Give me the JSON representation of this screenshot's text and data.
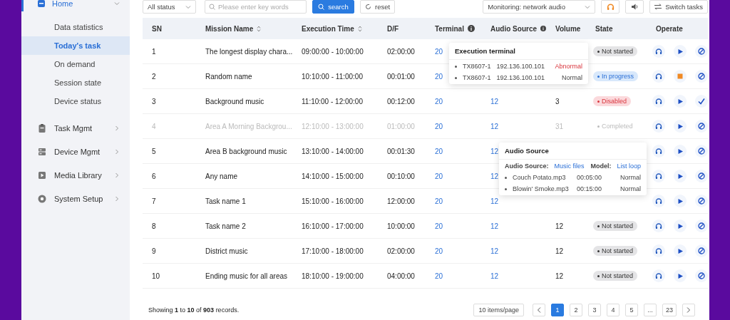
{
  "sidebar": {
    "items": [
      {
        "label": "Home",
        "expanded": true,
        "selected": true,
        "children": [
          {
            "label": "Data statistics",
            "selected": false
          },
          {
            "label": "Today's task",
            "selected": true
          },
          {
            "label": "On demand",
            "selected": false
          },
          {
            "label": "Session state",
            "selected": false
          },
          {
            "label": "Device status",
            "selected": false
          }
        ]
      },
      {
        "label": "Task Mgmt",
        "expanded": false,
        "selected": false
      },
      {
        "label": "Device Mgmt",
        "expanded": false,
        "selected": false
      },
      {
        "label": "Media Library",
        "expanded": false,
        "selected": false
      },
      {
        "label": "System Setup",
        "expanded": false,
        "selected": false
      }
    ]
  },
  "toolbar": {
    "status_filter": {
      "value": "All status"
    },
    "search": {
      "placeholder": "Please enter key words"
    },
    "search_button": "search",
    "reset_button": "reset",
    "monitor_select": {
      "value": "Monitoring: network audio"
    },
    "switch_button": "Switch tasks"
  },
  "table": {
    "columns": [
      {
        "label": "SN",
        "sortable": false,
        "info": false
      },
      {
        "label": "Mission Name",
        "sortable": true,
        "info": false
      },
      {
        "label": "Execution Time",
        "sortable": true,
        "info": false
      },
      {
        "label": "D/F",
        "sortable": false,
        "info": false
      },
      {
        "label": "Terminal",
        "sortable": false,
        "info": true
      },
      {
        "label": "Audio Source",
        "sortable": false,
        "info": true
      },
      {
        "label": "Volume",
        "sortable": false,
        "info": false
      },
      {
        "label": "State",
        "sortable": false,
        "info": false
      },
      {
        "label": "Operate",
        "sortable": false,
        "info": false
      }
    ],
    "rows": [
      {
        "sn": "1",
        "name": "The longest display chara...",
        "time": "09:00:00 - 10:00:00",
        "df": "02:00:00",
        "terminal": "20",
        "state": {
          "label": "Not started",
          "kind": "idle"
        },
        "actions": [
          {
            "kind": "listen"
          },
          {
            "kind": "play"
          },
          {
            "kind": "ban"
          }
        ],
        "muted": false
      },
      {
        "sn": "2",
        "name": "Random name",
        "time": "10:10:00 - 11:00:00",
        "df": "00:01:00",
        "terminal": "20",
        "state": {
          "label": "In progress",
          "kind": "running"
        },
        "actions": [
          {
            "kind": "listen"
          },
          {
            "kind": "stop"
          },
          {
            "kind": "ban"
          }
        ],
        "muted": false
      },
      {
        "sn": "3",
        "name": "Background music",
        "time": "11:10:00 - 12:00:00",
        "df": "00:12:00",
        "terminal": "20",
        "audio_source": "12",
        "volume": "3",
        "state": {
          "label": "Disabled",
          "kind": "disabled"
        },
        "actions": [
          {
            "kind": "listen"
          },
          {
            "kind": "play"
          },
          {
            "kind": "check"
          }
        ],
        "muted": false
      },
      {
        "sn": "4",
        "name": "Area A Morning Backgrou...",
        "time": "12:10:00 - 13:00:00",
        "df": "01:00:00",
        "terminal": "20",
        "audio_source": "12",
        "volume": "31",
        "state": {
          "label": "Completed",
          "kind": "done"
        },
        "actions": [
          {
            "kind": "listen"
          },
          {
            "kind": "play"
          },
          {
            "kind": "ban"
          }
        ],
        "muted": true
      },
      {
        "sn": "5",
        "name": "Area B background music",
        "time": "13:10:00 - 14:00:00",
        "df": "00:01:30",
        "terminal": "20",
        "audio_source": "12",
        "actions": [
          {
            "kind": "listen"
          },
          {
            "kind": "play"
          },
          {
            "kind": "ban"
          }
        ],
        "muted": false
      },
      {
        "sn": "6",
        "name": "Any name",
        "time": "14:10:00 - 15:00:00",
        "df": "00:10:00",
        "terminal": "20",
        "audio_source": "12",
        "actions": [
          {
            "kind": "listen"
          },
          {
            "kind": "play"
          },
          {
            "kind": "ban"
          }
        ],
        "muted": false
      },
      {
        "sn": "7",
        "name": "Task name 1",
        "time": "15:10:00 - 16:00:00",
        "df": "12:00:00",
        "terminal": "20",
        "audio_source": "12",
        "actions": [
          {
            "kind": "listen"
          },
          {
            "kind": "play"
          },
          {
            "kind": "ban"
          }
        ],
        "muted": false
      },
      {
        "sn": "8",
        "name": "Task name 2",
        "time": "16:10:00 - 17:00:00",
        "df": "10:00:00",
        "terminal": "20",
        "audio_source": "12",
        "volume": "12",
        "state": {
          "label": "Not started",
          "kind": "idle"
        },
        "actions": [
          {
            "kind": "listen"
          },
          {
            "kind": "play"
          },
          {
            "kind": "ban"
          }
        ],
        "muted": false
      },
      {
        "sn": "9",
        "name": "District music",
        "time": "17:10:00 - 18:00:00",
        "df": "02:00:00",
        "terminal": "20",
        "audio_source": "12",
        "volume": "12",
        "state": {
          "label": "Not started",
          "kind": "idle"
        },
        "actions": [
          {
            "kind": "listen"
          },
          {
            "kind": "play"
          },
          {
            "kind": "ban"
          }
        ],
        "muted": false
      },
      {
        "sn": "10",
        "name": "Ending music for all areas",
        "time": "18:10:00 - 19:00:00",
        "df": "04:00:00",
        "terminal": "20",
        "audio_source": "12",
        "volume": "12",
        "state": {
          "label": "Not started",
          "kind": "idle"
        },
        "actions": [
          {
            "kind": "listen"
          },
          {
            "kind": "play"
          },
          {
            "kind": "ban"
          }
        ],
        "muted": false
      }
    ]
  },
  "terminal_popover": {
    "title": "Execution terminal",
    "items": [
      {
        "device": "TX8607-1",
        "ip": "192.136.100.101",
        "status": "Abnormal",
        "kind": "abnormal"
      },
      {
        "device": "TX8607-1",
        "ip": "192.136.100.101",
        "status": "Normal",
        "kind": "normal"
      }
    ]
  },
  "audio_popover": {
    "title": "Audio Source",
    "source_label": "Audio Source:",
    "source_value": "Music files",
    "mode_label": "Model:",
    "mode_value": "List loop",
    "files": [
      {
        "name": "Couch Potato.mp3",
        "duration": "00:05:00",
        "status": "Normal"
      },
      {
        "name": "Blowin' Smoke.mp3",
        "duration": "00:15:00",
        "status": "Normal"
      }
    ]
  },
  "footer": {
    "summary": "Showing **1** to **10** of **903** records.",
    "page_size": "10 items/page",
    "pages": [
      {
        "label": "1",
        "selected": true
      },
      {
        "label": "2",
        "selected": false
      },
      {
        "label": "3",
        "selected": false
      },
      {
        "label": "4",
        "selected": false
      },
      {
        "label": "5",
        "selected": false
      },
      {
        "label": "...",
        "selected": false
      },
      {
        "label": "23",
        "selected": false
      }
    ]
  }
}
